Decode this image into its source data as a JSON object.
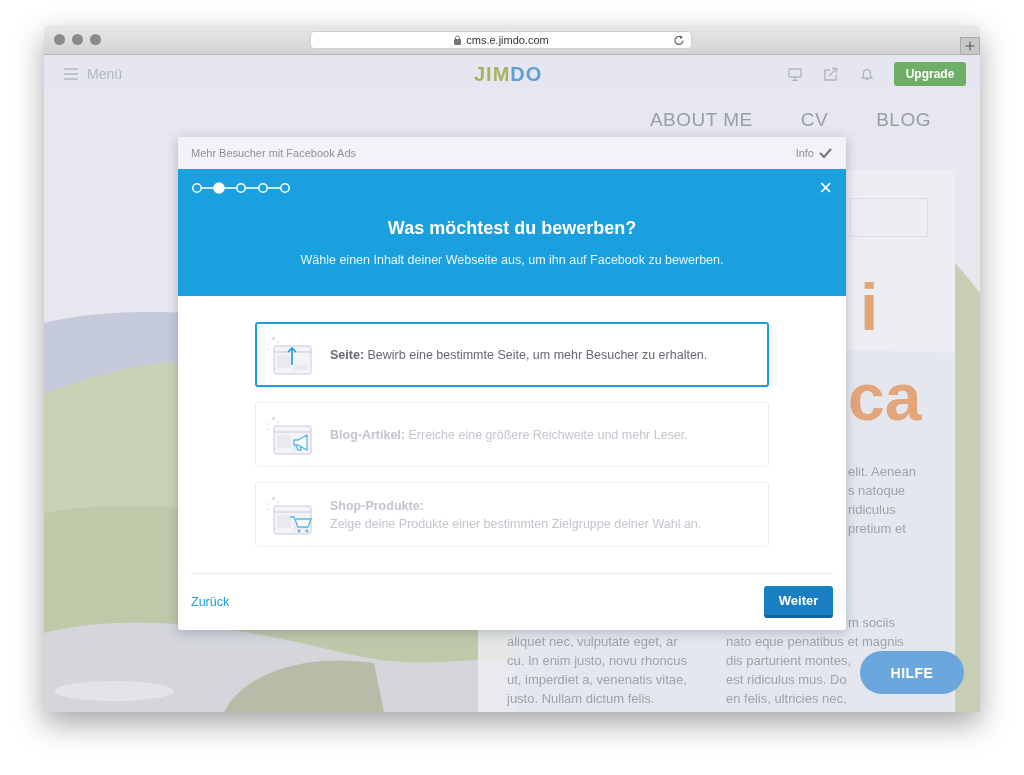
{
  "browser": {
    "url": "cms.e.jimdo.com"
  },
  "toolbar": {
    "menu_label": "Menü",
    "logo": "JIMDO",
    "upgrade_button": "Upgrade"
  },
  "site": {
    "nav": [
      "ABOUT ME",
      "CV",
      "BLOG"
    ],
    "heading_lines": [
      "i",
      "ca"
    ],
    "intro_lines": [
      "elit. Aenean",
      "s natoque",
      "ridiculus",
      "pretium et"
    ],
    "column_1": [
      "aliquet nec, vulputate eget, ar",
      "cu. In enim justo, novu rhoncus",
      "ut, imperdiet a, venenatis vitae,",
      "justo. Nullam dictum felis."
    ],
    "column_2": [
      "m sociis",
      "nato eque penatibus et magnis",
      "dis parturient montes,",
      "est ridiculus mus. Do",
      "en felis, ultricies nec,"
    ],
    "help_button": "HILFE"
  },
  "dialog": {
    "bar_title": "Mehr Besucher mit Facebook Ads",
    "info_label": "Info",
    "steps": [
      {
        "selected": false
      },
      {
        "selected": true
      },
      {
        "selected": false
      },
      {
        "selected": false
      },
      {
        "selected": false
      }
    ],
    "close": "×",
    "title": "Was möchtest du bewerben?",
    "subtitle": "Wähle einen Inhalt deiner Webseite aus, um ihn auf Facebook zu bewerben.",
    "options": [
      {
        "kind": "page",
        "text": "**Seite:** Bewirb eine bestimmte Seite, um mehr Besucher zu erhalten.",
        "selected": true
      },
      {
        "kind": "blog",
        "text": "**Blog-Artikel:** Erreiche eine größere Reichweite und mehr Leser.",
        "selected": false
      },
      {
        "kind": "shop",
        "title": "Shop-Produkte:",
        "text": "Zeige deine Produkte einer bestimmten Zielgruppe deiner Wahl an.",
        "selected": false
      }
    ],
    "back_link": "Zurück",
    "next_button": "Weiter"
  }
}
